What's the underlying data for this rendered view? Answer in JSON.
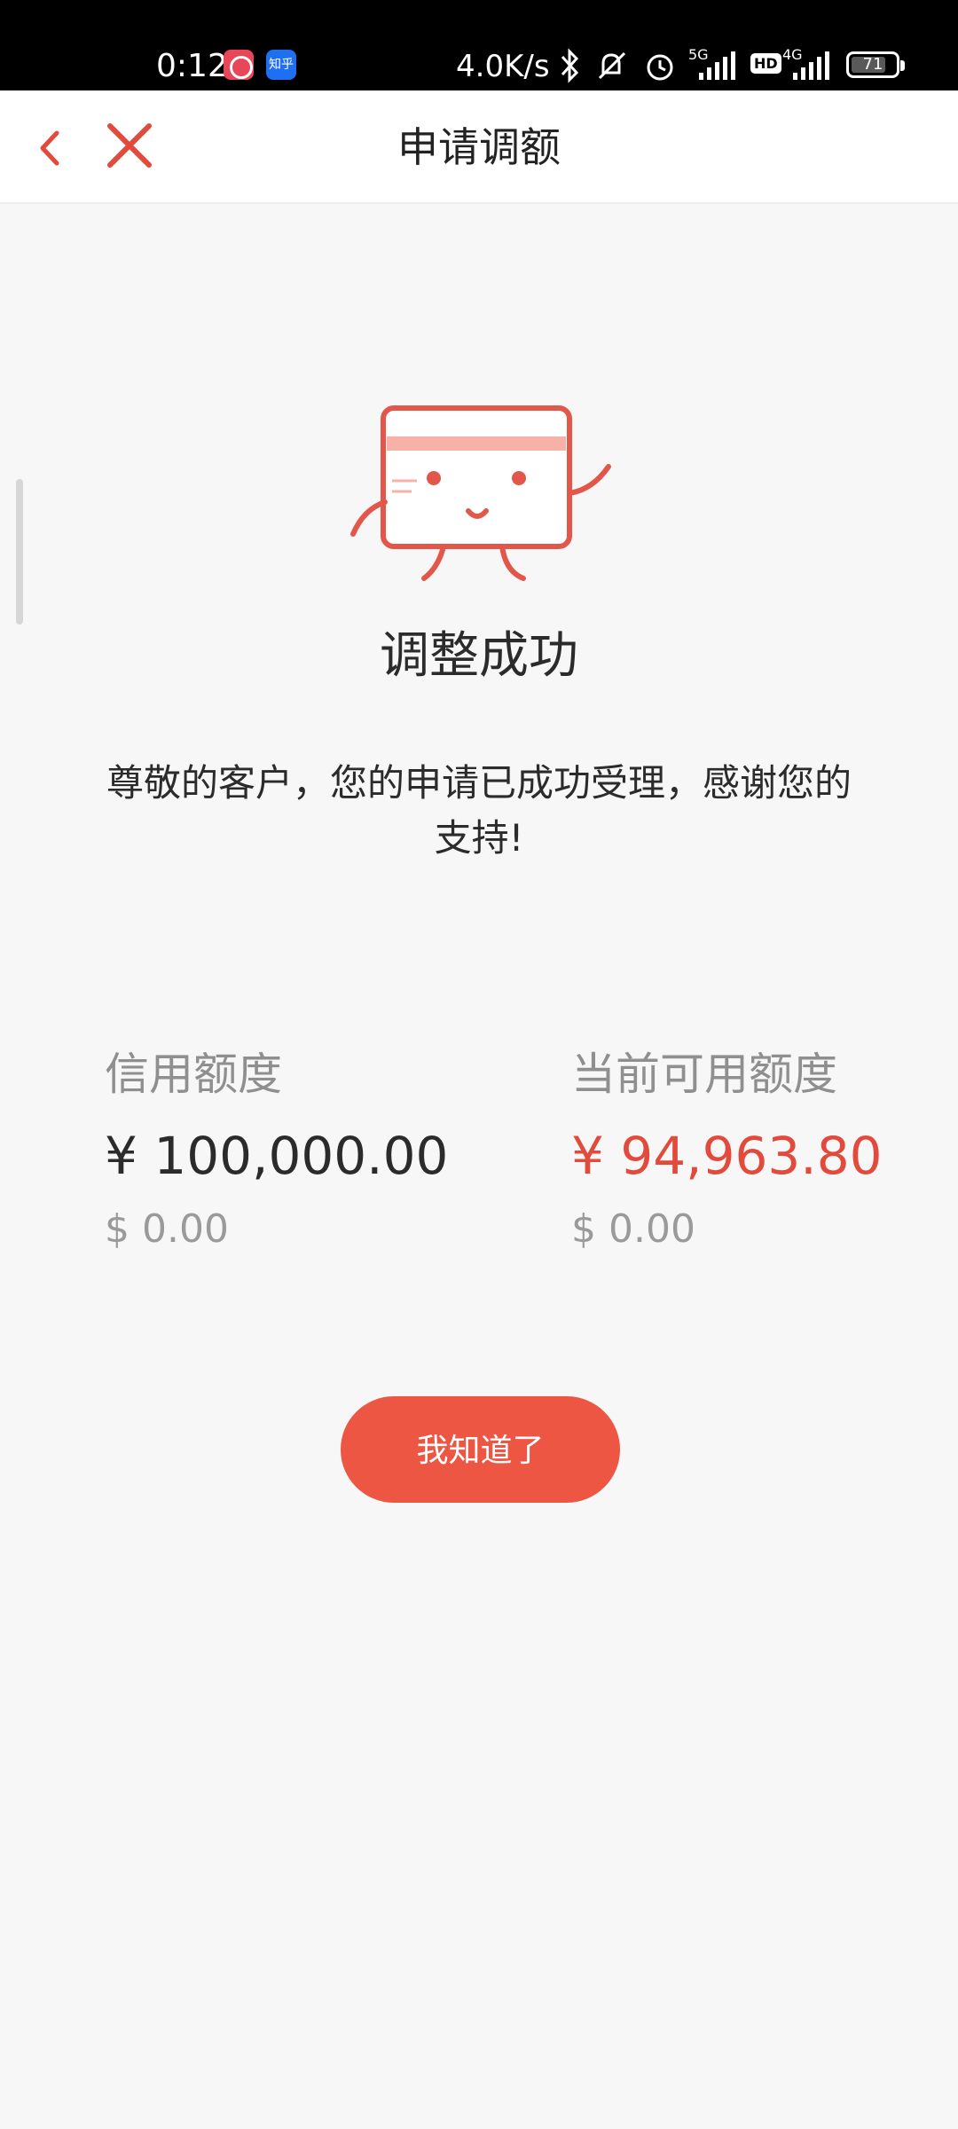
{
  "status_bar": {
    "time": "0:12",
    "network_speed": "4.0K/s",
    "signal_5g": "5G",
    "signal_4g": "4G",
    "hd": "HD",
    "battery": "71",
    "app_icon_2_text": "知乎"
  },
  "header": {
    "title": "申请调额"
  },
  "result": {
    "title": "调整成功",
    "message": "尊敬的客户，您的申请已成功受理，感谢您的支持!"
  },
  "limits": {
    "credit": {
      "label": "信用额度",
      "cny": "¥ 100,000.00",
      "usd": "$ 0.00"
    },
    "available": {
      "label": "当前可用额度",
      "cny": "¥ 94,963.80",
      "usd": "$ 0.00"
    }
  },
  "actions": {
    "confirm_label": "我知道了"
  },
  "colors": {
    "accent": "#ec5643",
    "amount_red": "#e24a3b"
  }
}
